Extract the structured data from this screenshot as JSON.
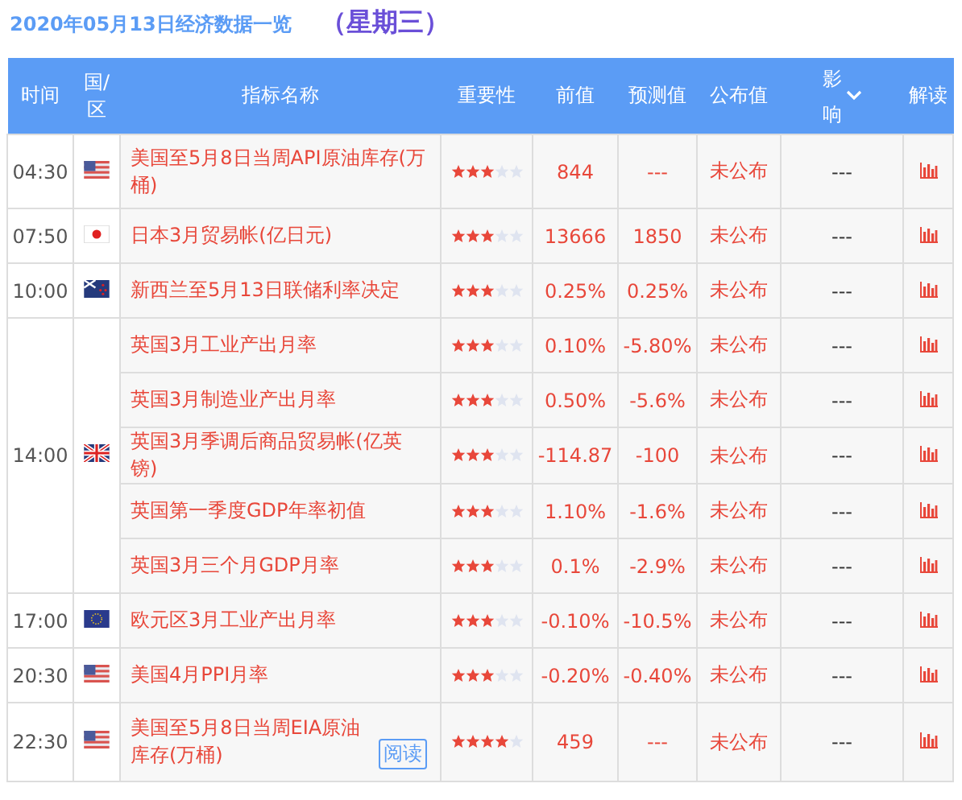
{
  "title": {
    "date": "2020年05月13日经济数据一览",
    "weekday": "（星期三）"
  },
  "columns": [
    "时间",
    "国/区",
    "指标名称",
    "重要性",
    "前值",
    "预测值",
    "公布值",
    "影响",
    "解读"
  ],
  "groups": [
    {
      "time": "04:30",
      "kind": "us",
      "events": [
        {
          "name": "美国至5月8日当周API原油库存(万桶)",
          "stars": 3,
          "previous": "844",
          "forecast": "---",
          "actual": "未公布",
          "impact": "---"
        }
      ]
    },
    {
      "time": "07:50",
      "kind": "jp",
      "events": [
        {
          "name": "日本3月贸易帐(亿日元)",
          "stars": 3,
          "previous": "13666",
          "forecast": "1850",
          "actual": "未公布",
          "impact": "---"
        }
      ]
    },
    {
      "time": "10:00",
      "kind": "nz",
      "events": [
        {
          "name": "新西兰至5月13日联储利率决定",
          "stars": 3,
          "previous": "0.25%",
          "forecast": "0.25%",
          "actual": "未公布",
          "impact": "---"
        }
      ]
    },
    {
      "time": "14:00",
      "kind": "uk",
      "events": [
        {
          "name": "英国3月工业产出月率",
          "stars": 3,
          "previous": "0.10%",
          "forecast": "-5.80%",
          "actual": "未公布",
          "impact": "---"
        },
        {
          "name": "英国3月制造业产出月率",
          "stars": 3,
          "previous": "0.50%",
          "forecast": "-5.6%",
          "actual": "未公布",
          "impact": "---"
        },
        {
          "name": "英国3月季调后商品贸易帐(亿英镑)",
          "stars": 3,
          "previous": "-114.87",
          "forecast": "-100",
          "actual": "未公布",
          "impact": "---"
        },
        {
          "name": "英国第一季度GDP年率初值",
          "stars": 3,
          "previous": "1.10%",
          "forecast": "-1.6%",
          "actual": "未公布",
          "impact": "---"
        },
        {
          "name": "英国3月三个月GDP月率",
          "stars": 3,
          "previous": "0.1%",
          "forecast": "-2.9%",
          "actual": "未公布",
          "impact": "---"
        }
      ]
    },
    {
      "time": "17:00",
      "kind": "eu",
      "events": [
        {
          "name": "欧元区3月工业产出月率",
          "stars": 3,
          "previous": "-0.10%",
          "forecast": "-10.5%",
          "actual": "未公布",
          "impact": "---"
        }
      ]
    },
    {
      "time": "20:30",
      "kind": "us",
      "events": [
        {
          "name": "美国4月PPI月率",
          "stars": 3,
          "previous": "-0.20%",
          "forecast": "-0.40%",
          "actual": "未公布",
          "impact": "---"
        }
      ]
    },
    {
      "time": "22:30",
      "kind": "us",
      "events": [
        {
          "name": "美国至5月8日当周EIA原油库存(万桶)",
          "read_link": "阅读",
          "stars": 4,
          "previous": "459",
          "forecast": "---",
          "actual": "未公布",
          "impact": "---"
        }
      ]
    }
  ]
}
